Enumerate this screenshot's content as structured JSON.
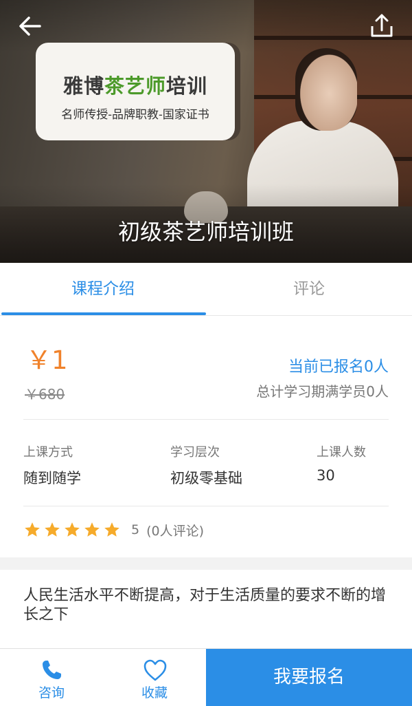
{
  "colors": {
    "accent": "#2b8ee6",
    "price": "#f0822b",
    "star": "#f6ab2b",
    "logo_accent": "#4c9a2a"
  },
  "header": {
    "back_icon": "arrow-left-icon",
    "share_icon": "share-icon",
    "logo": {
      "title_prefix": "雅博",
      "title_accent": "茶艺师",
      "title_suffix": "培训",
      "subtitle": "名师传授-品牌职教-国家证书"
    },
    "course_title": "初级茶艺师培训班"
  },
  "tabs": [
    {
      "label": "课程介绍",
      "active": true
    },
    {
      "label": "评论",
      "active": false
    }
  ],
  "pricing": {
    "price": "￥1",
    "original_price": "￥680",
    "enrolled": "当前已报名0人",
    "finished": "总计学习期满学员0人"
  },
  "meta": [
    {
      "label": "上课方式",
      "value": "随到随学"
    },
    {
      "label": "学习层次",
      "value": "初级零基础"
    },
    {
      "label": "上课人数",
      "value": "30"
    }
  ],
  "rating": {
    "stars": 5,
    "score": "5",
    "reviews": "(0人评论)"
  },
  "description": "人民生活水平不断提高，对于生活质量的要求不断的增长之下",
  "bottom_bar": {
    "consult": {
      "label": "咨询",
      "icon": "phone-icon"
    },
    "favorite": {
      "label": "收藏",
      "icon": "heart-icon"
    },
    "signup": "我要报名"
  }
}
